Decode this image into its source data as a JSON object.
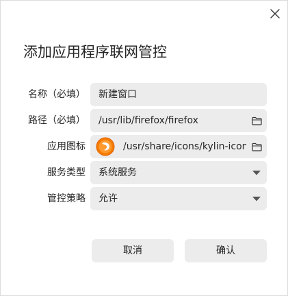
{
  "dialog": {
    "title": "添加应用程序联网管控"
  },
  "form": {
    "name": {
      "label": "名称（必填）",
      "value": "新建窗口"
    },
    "path": {
      "label": "路径（必填）",
      "value": "/usr/lib/firefox/firefox"
    },
    "icon": {
      "label": "应用图标",
      "value": "/usr/share/icons/kylin-icon-"
    },
    "service_type": {
      "label": "服务类型",
      "value": "系统服务"
    },
    "policy": {
      "label": "管控策略",
      "value": "允许"
    }
  },
  "buttons": {
    "cancel": "取消",
    "confirm": "确认"
  },
  "colors": {
    "field_bg": "#ececec",
    "text": "#262626",
    "app_icon_orange": "#f57c00"
  },
  "icons": {
    "close": "close-icon",
    "folder": "folder-icon",
    "dropdown": "triangle-down-icon",
    "app": "firefox-app-icon"
  }
}
